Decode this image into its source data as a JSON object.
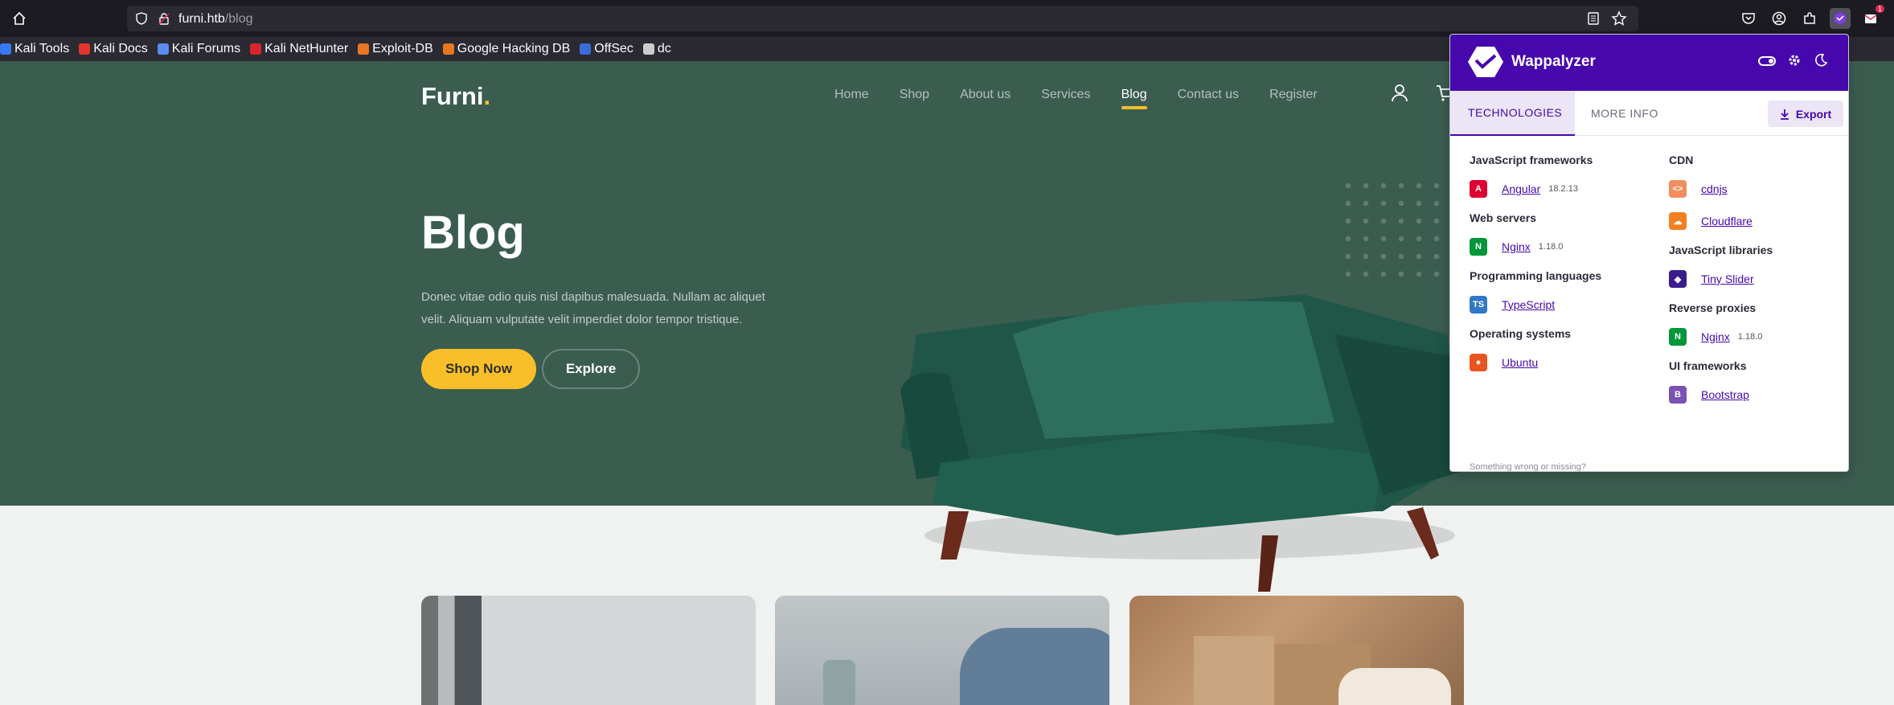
{
  "browser": {
    "url_host": "furni.htb",
    "url_path": "/blog",
    "bookmarks": [
      {
        "label": "Kali Tools",
        "color": "#367bf0"
      },
      {
        "label": "Kali Docs",
        "color": "#e3342f"
      },
      {
        "label": "Kali Forums",
        "color": "#5a8dee"
      },
      {
        "label": "Kali NetHunter",
        "color": "#d9262c"
      },
      {
        "label": "Exploit-DB",
        "color": "#e87722"
      },
      {
        "label": "Google Hacking DB",
        "color": "#e87722"
      },
      {
        "label": "OffSec",
        "color": "#3d6bd9"
      },
      {
        "label": "dc",
        "color": "#cccccc"
      }
    ],
    "notification_badge": "1"
  },
  "site": {
    "logo": "Furni",
    "logo_dot": ".",
    "nav": [
      "Home",
      "Shop",
      "About us",
      "Services",
      "Blog",
      "Contact us",
      "Register"
    ],
    "active_nav": "Blog",
    "hero_title": "Blog",
    "hero_text": "Donec vitae odio quis nisl dapibus malesuada. Nullam ac aliquet velit. Aliquam vulputate velit imperdiet dolor tempor tristique.",
    "shop_now": "Shop Now",
    "explore": "Explore",
    "colors": {
      "primary": "#3b5d50",
      "accent": "#f9bf29"
    }
  },
  "wappalyzer": {
    "brand": "Wappalyzer",
    "tabs": [
      "TECHNOLOGIES",
      "MORE INFO"
    ],
    "export": "Export",
    "left_column": [
      {
        "category": "JavaScript frameworks",
        "items": [
          {
            "name": "Angular",
            "version": "18.2.13",
            "icon": "angular-icon",
            "color": "#dd0031",
            "glyph": "A"
          }
        ]
      },
      {
        "category": "Web servers",
        "items": [
          {
            "name": "Nginx",
            "version": "1.18.0",
            "icon": "nginx-icon",
            "color": "#009639",
            "glyph": "N"
          }
        ]
      },
      {
        "category": "Programming languages",
        "items": [
          {
            "name": "TypeScript",
            "version": "",
            "icon": "typescript-icon",
            "color": "#3178c6",
            "glyph": "TS"
          }
        ]
      },
      {
        "category": "Operating systems",
        "items": [
          {
            "name": "Ubuntu",
            "version": "",
            "icon": "ubuntu-icon",
            "color": "#e95420",
            "glyph": "●"
          }
        ]
      }
    ],
    "right_column": [
      {
        "category": "CDN",
        "items": [
          {
            "name": "cdnjs",
            "version": "",
            "icon": "cdnjs-icon",
            "color": "#f28e5c",
            "glyph": "<>"
          },
          {
            "name": "Cloudflare",
            "version": "",
            "icon": "cloudflare-icon",
            "color": "#f38020",
            "glyph": "☁"
          }
        ]
      },
      {
        "category": "JavaScript libraries",
        "items": [
          {
            "name": "Tiny Slider",
            "version": "",
            "icon": "tiny-slider-icon",
            "color": "#3a1c8c",
            "glyph": "◆"
          }
        ]
      },
      {
        "category": "Reverse proxies",
        "items": [
          {
            "name": "Nginx",
            "version": "1.18.0",
            "icon": "nginx-icon",
            "color": "#009639",
            "glyph": "N"
          }
        ]
      },
      {
        "category": "UI frameworks",
        "items": [
          {
            "name": "Bootstrap",
            "version": "",
            "icon": "bootstrap-icon",
            "color": "#7952b3",
            "glyph": "B"
          }
        ]
      }
    ],
    "footer": "Something wrong or missing?"
  }
}
